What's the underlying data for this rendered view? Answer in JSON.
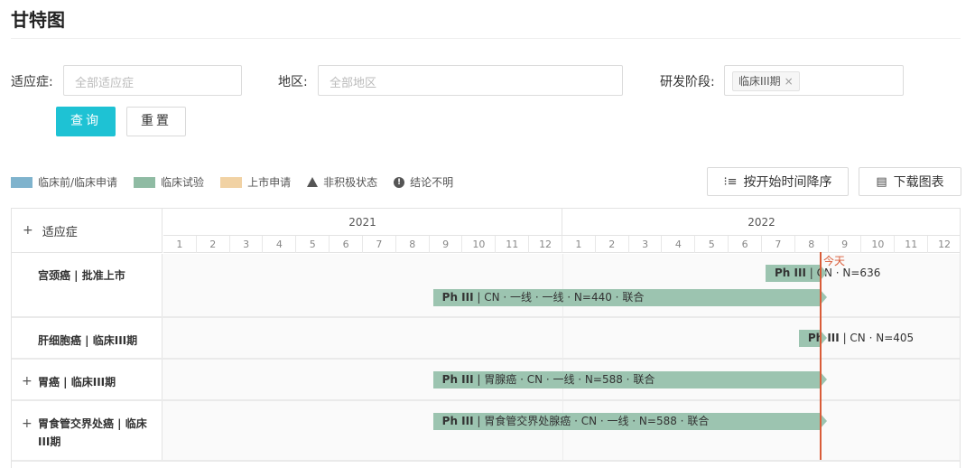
{
  "page": {
    "title": "甘特图"
  },
  "filters": {
    "indication": {
      "label": "适应症:",
      "placeholder": "全部适应症"
    },
    "region": {
      "label": "地区:",
      "placeholder": "全部地区"
    },
    "phase": {
      "label": "研发阶段:",
      "tag": "临床III期",
      "remove": "×"
    }
  },
  "buttons": {
    "query": "查询",
    "reset": "重置",
    "sort": "按开始时间降序",
    "download": "下载图表"
  },
  "legend": [
    {
      "label": "临床前/临床申请",
      "color": "#7fb3cd"
    },
    {
      "label": "临床试验",
      "color": "#8fbba3"
    },
    {
      "label": "上市申请",
      "color": "#f1d2a4"
    },
    {
      "label": "非积极状态",
      "icon": "triangle-icon"
    },
    {
      "label": "结论不明",
      "icon": "info-icon"
    }
  ],
  "gantt": {
    "header_label": "适应症",
    "years": [
      "2021",
      "2022"
    ],
    "months": [
      "1",
      "2",
      "3",
      "4",
      "5",
      "6",
      "7",
      "8",
      "9",
      "10",
      "11",
      "12",
      "1",
      "2",
      "3",
      "4",
      "5",
      "6",
      "7",
      "8",
      "9",
      "10",
      "11",
      "12"
    ],
    "today_label": "今天",
    "rows": [
      {
        "label": "宫颈癌 | 批准上市",
        "expandable": false,
        "bars": [
          {
            "start": "2022-07",
            "end": "2022-08",
            "ph": "Ph III",
            "text": " | CN",
            "after": " · N=636"
          },
          {
            "start": "2021-09",
            "end": "2022-08",
            "ph": "Ph III",
            "text": " | CN · 一线 · 一线 · N=440 · 联合",
            "after": ""
          }
        ]
      },
      {
        "label": "肝细胞癌 | 临床III期",
        "expandable": false,
        "bars": [
          {
            "start": "2022-08",
            "end": "2022-08",
            "ph": "Ph III",
            "text": "",
            "after": " | CN · N=405"
          }
        ]
      },
      {
        "label": "胃癌 | 临床III期",
        "expandable": true,
        "bars": [
          {
            "start": "2021-09",
            "end": "2022-08",
            "ph": "Ph III",
            "text": " | 胃腺癌 · CN · 一线 · N=588 · 联合",
            "after": ""
          }
        ]
      },
      {
        "label": "胃食管交界处癌 | 临床III期",
        "expandable": true,
        "bars": [
          {
            "start": "2021-09",
            "end": "2022-08",
            "ph": "Ph III",
            "text": " | 胃食管交界处腺癌 · CN · 一线 · N=588 · 联合",
            "after": ""
          }
        ]
      }
    ]
  }
}
